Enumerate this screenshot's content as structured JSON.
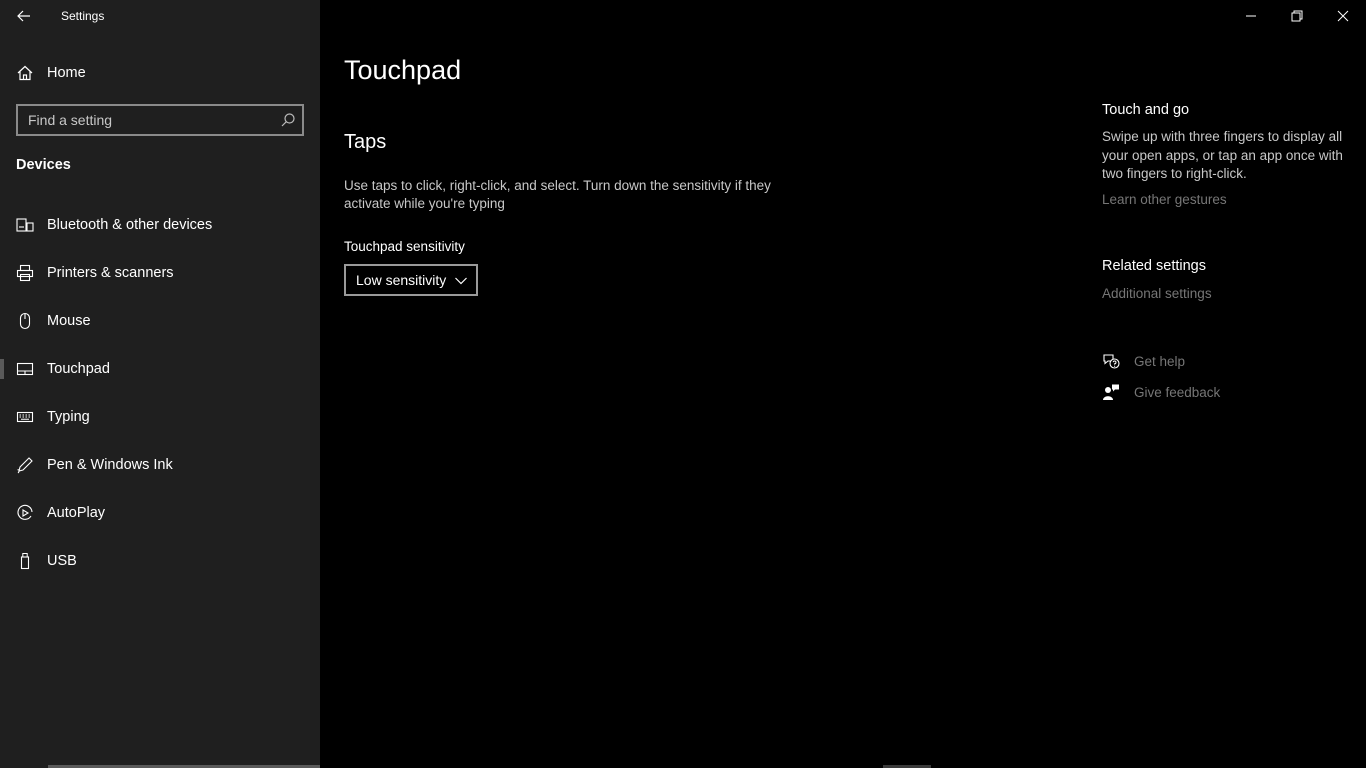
{
  "window": {
    "title": "Settings",
    "controls": {
      "minimize": "minimize-icon",
      "restore": "restore-icon",
      "close": "close-icon"
    }
  },
  "sidebar": {
    "home_label": "Home",
    "search": {
      "placeholder": "Find a setting",
      "value": ""
    },
    "section_title": "Devices",
    "items": [
      {
        "label": "Bluetooth & other devices",
        "icon": "bluetooth-devices-icon"
      },
      {
        "label": "Printers & scanners",
        "icon": "printer-icon"
      },
      {
        "label": "Mouse",
        "icon": "mouse-icon"
      },
      {
        "label": "Touchpad",
        "icon": "touchpad-icon",
        "selected": true
      },
      {
        "label": "Typing",
        "icon": "keyboard-icon"
      },
      {
        "label": "Pen & Windows Ink",
        "icon": "pen-icon"
      },
      {
        "label": "AutoPlay",
        "icon": "autoplay-icon"
      },
      {
        "label": "USB",
        "icon": "usb-icon"
      }
    ]
  },
  "main": {
    "page_title": "Touchpad",
    "section_title": "Taps",
    "description": "Use taps to click, right-click, and select. Turn down the sensitivity if they activate while you're typing",
    "sensitivity": {
      "label": "Touchpad sensitivity",
      "selected": "Low sensitivity"
    }
  },
  "right_panel": {
    "touch_and_go": {
      "title": "Touch and go",
      "text": "Swipe up with three fingers to display all your open apps, or tap an app once with two fingers to right-click.",
      "link": "Learn other gestures"
    },
    "related": {
      "title": "Related settings",
      "link": "Additional settings"
    },
    "help": {
      "get_help": "Get help",
      "feedback": "Give feedback"
    }
  },
  "colors": {
    "sidebar_bg": "#1f1f1f",
    "main_bg": "#000000",
    "text": "#ffffff",
    "secondary_text": "#c8c8c8",
    "link_text": "#767676"
  }
}
